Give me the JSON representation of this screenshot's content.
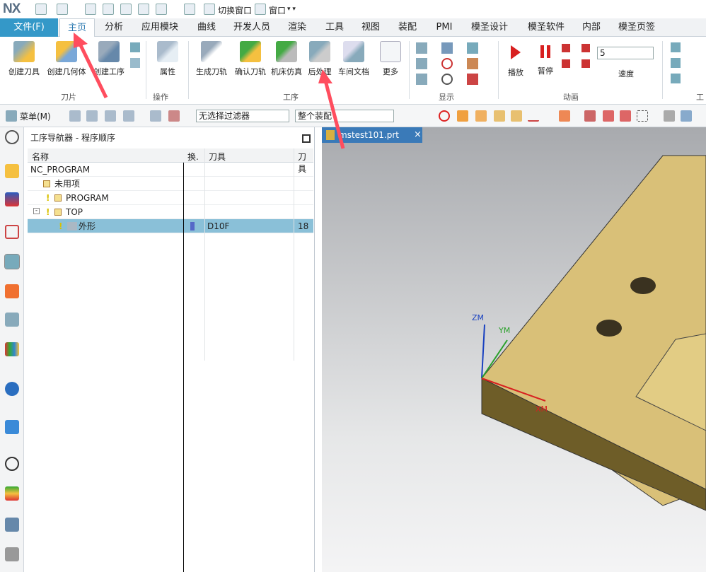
{
  "title_bar": {
    "logo": "NX",
    "switch_window": "切换窗口",
    "window_menu": "窗口"
  },
  "tabs": [
    {
      "label": "文件(F)"
    },
    {
      "label": "主页"
    },
    {
      "label": "分析"
    },
    {
      "label": "应用模块"
    },
    {
      "label": "曲线"
    },
    {
      "label": "开发人员"
    },
    {
      "label": "渲染"
    },
    {
      "label": "工具"
    },
    {
      "label": "视图"
    },
    {
      "label": "装配"
    },
    {
      "label": "PMI"
    },
    {
      "label": "模圣设计"
    },
    {
      "label": "模圣软件"
    },
    {
      "label": "内部"
    },
    {
      "label": "模圣页签"
    }
  ],
  "ribbon": {
    "blade_group": {
      "label": "刀片",
      "buttons": [
        "创建刀具",
        "创建几何体",
        "创建工序"
      ]
    },
    "ops_group": {
      "label": "操作",
      "buttons": [
        "属性"
      ]
    },
    "proc_group": {
      "label": "工序",
      "buttons": [
        "生成刀轨",
        "确认刀轨",
        "机床仿真",
        "后处理",
        "车间文档",
        "更多"
      ]
    },
    "display_group": {
      "label": "显示"
    },
    "anim_group": {
      "label": "动画",
      "buttons": [
        "播放",
        "暂停"
      ],
      "speed_value": "5",
      "speed_label": "速度"
    },
    "work_group": {
      "label": "工"
    }
  },
  "toolbar2": {
    "menu": "菜单(M)",
    "filter": "无选择过滤器",
    "assembly": "整个装配"
  },
  "navigator": {
    "title": "工序导航器 - 程序顺序",
    "columns": [
      "名称",
      "换.",
      "刀具",
      "刀具"
    ],
    "rows": [
      {
        "name": "NC_PROGRAM",
        "tool": "",
        "num": ""
      },
      {
        "name": "未用项",
        "tool": "",
        "num": ""
      },
      {
        "name": "PROGRAM",
        "tool": "",
        "num": ""
      },
      {
        "name": "TOP",
        "tool": "",
        "num": ""
      },
      {
        "name": "外形",
        "tool": "D10F",
        "num": "18"
      }
    ]
  },
  "viewport": {
    "tab": "mstest101.prt",
    "axes": {
      "z": "ZM",
      "y": "YM",
      "x": "XM"
    }
  },
  "colors": {
    "accent": "#3498c8",
    "part": "#e8d088",
    "arrow": "#ff4d5e"
  }
}
